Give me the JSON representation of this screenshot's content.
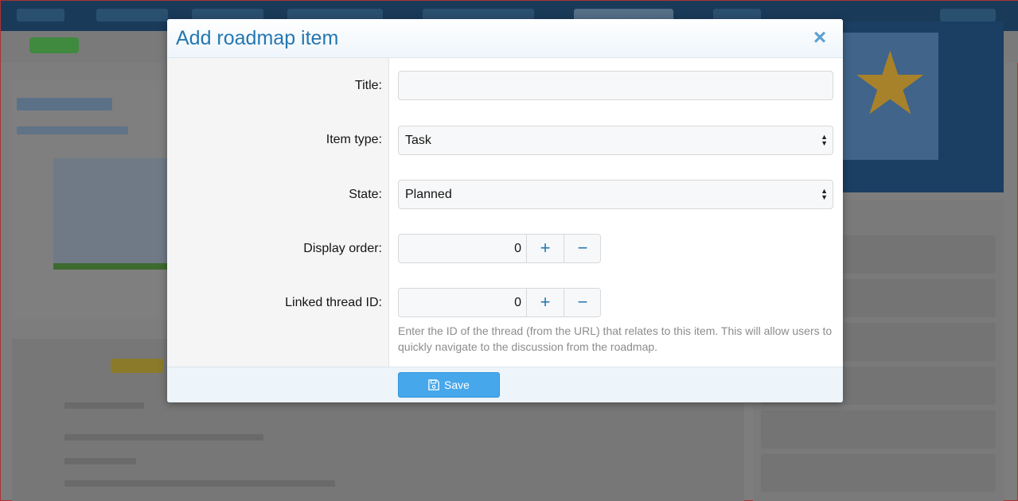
{
  "modal": {
    "title": "Add roadmap item",
    "close_icon": "close-icon",
    "fields": {
      "title": {
        "label": "Title:",
        "value": ""
      },
      "item_type": {
        "label": "Item type:",
        "selected": "Task"
      },
      "state": {
        "label": "State:",
        "selected": "Planned"
      },
      "display_order": {
        "label": "Display order:",
        "value": "0",
        "plus": "+",
        "minus": "−"
      },
      "linked_thread_id": {
        "label": "Linked thread ID:",
        "value": "0",
        "plus": "+",
        "minus": "−",
        "hint": "Enter the ID of the thread (from the URL) that relates to this item. This will allow users to quickly navigate to the discussion from the roadmap."
      }
    },
    "footer": {
      "save_label": "Save",
      "save_icon": "save-icon"
    }
  },
  "colors": {
    "title": "#2577b1",
    "save_button": "#47a7eb",
    "stepper_icon": "#2577b1"
  }
}
